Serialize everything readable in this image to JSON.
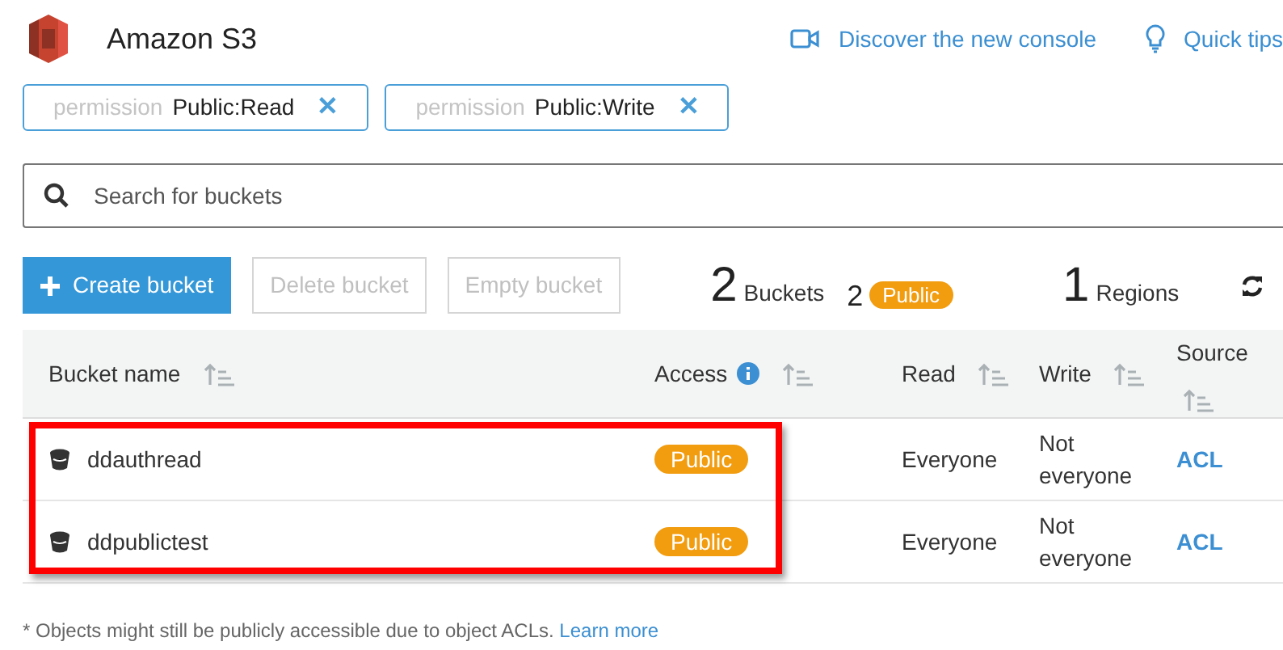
{
  "header": {
    "title": "Amazon S3",
    "links": [
      {
        "kind": "video",
        "label": "Discover the new console"
      },
      {
        "kind": "tip",
        "label": "Quick tips"
      }
    ]
  },
  "filters": [
    {
      "key": "permission",
      "value": "Public:Read",
      "remove": "✕"
    },
    {
      "key": "permission",
      "value": "Public:Write",
      "remove": "✕"
    }
  ],
  "search": {
    "placeholder": "Search for buckets"
  },
  "actions": [
    {
      "label": "Create bucket",
      "kind": "primary",
      "disabled": false
    },
    {
      "label": "Delete bucket",
      "kind": "plain",
      "disabled": true
    },
    {
      "label": "Empty bucket",
      "kind": "plain",
      "disabled": true
    }
  ],
  "summary": {
    "buckets_count": "2",
    "buckets_label": "Buckets",
    "public_count": "2",
    "public_badge": "Public",
    "regions_count": "1",
    "regions_label": "Regions"
  },
  "table": {
    "columns": [
      {
        "label": "Bucket name",
        "info": false
      },
      {
        "label": "Access",
        "info": true
      },
      {
        "label": "Read",
        "info": false
      },
      {
        "label": "Write",
        "info": false
      },
      {
        "label": "Source",
        "info": false
      }
    ],
    "rows": [
      {
        "name": "ddauthread",
        "access": "Public",
        "read": "Everyone",
        "write": "Not everyone",
        "source": "ACL"
      },
      {
        "name": "ddpublictest",
        "access": "Public",
        "read": "Everyone",
        "write": "Not everyone",
        "source": "ACL"
      }
    ]
  },
  "footnote": {
    "text": "* Objects might still be publicly accessible due to object ACLs.",
    "link": "Learn more"
  }
}
